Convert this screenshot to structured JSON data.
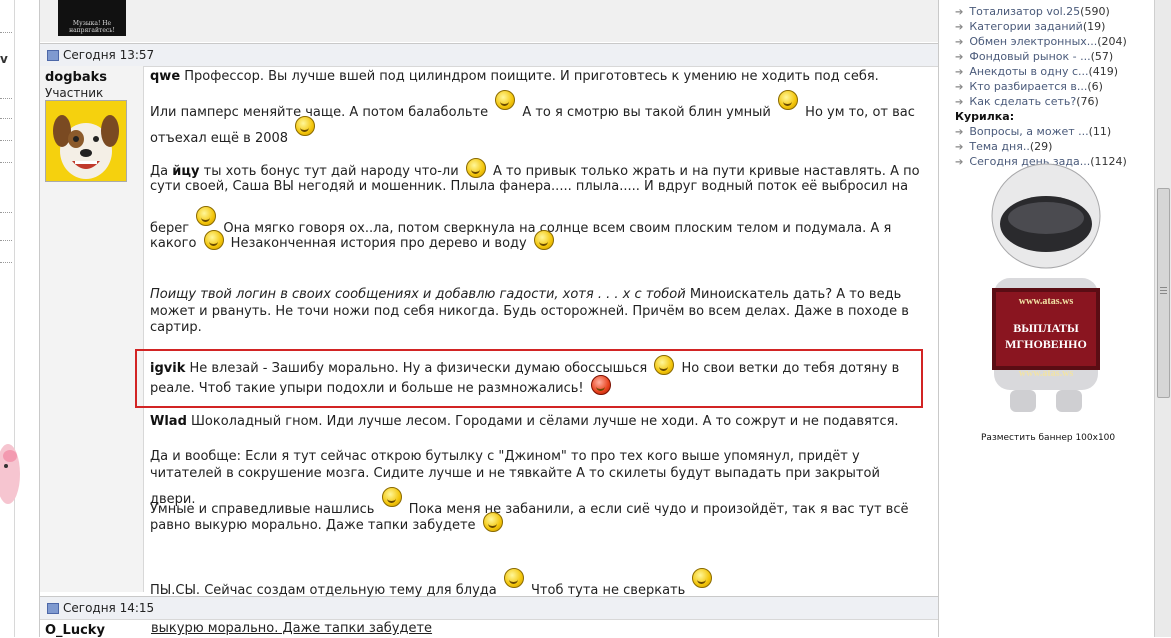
{
  "left_strip": {
    "letter": "v"
  },
  "previous_post": {
    "avatar_caption": "Музыка! Не напрягайтесь!"
  },
  "post1": {
    "date": "Сегодня 13:57",
    "author": "dogbaks",
    "role": "Участник",
    "lines": [
      {
        "bold": "qwe",
        "text": " Профессор. Вы лучше вшей под цилиндром поищите. И приготовтесь к умению не ходить под себя."
      },
      {
        "text": "Или памперс меняйте чаще. А потом балабольте ",
        "text2": " А то я смотрю вы такой блин умный ",
        "text3": " Но ум то, от вас"
      },
      {
        "text": "отъехал ещё в 2008 "
      },
      {
        "text": "Да ",
        "bold": "йцу",
        "text2": " ты хоть бонус тут дай народу что-ли ",
        "text3": " А то привык только жрать и на пути кривые наставлять. А по"
      },
      {
        "text": "сути своей, Саша ВЫ негодяй и мошенник. Плыла фанера..... плыла..... И вдруг водный поток её выбросил на"
      },
      {
        "text": "берег ",
        "text2": " Она мягко говоря ох..ла, потом сверкнула на солнце всем своим плоским телом и подумала. А я"
      },
      {
        "text": "какого ",
        "text2": " Незаконченная история про дерево и воду "
      },
      {
        "italic": "Поищу твой логин в своих сообщениях и добавлю гадости, хотя . . . x с тобой",
        "text": " Миноискатель дать? А то ведь"
      },
      {
        "text": "может и рвануть. Не точи ножи под себя никогда. Будь осторожней. Причём во всем делах. Даже в походе в"
      },
      {
        "text": "сартир."
      },
      {
        "bold": "igvik",
        "text": " Не влезай - Зашибу морально. Ну а физически думаю обоссышься ",
        "text2": " Но свои ветки до тебя дотяну в"
      },
      {
        "text": "реале. Чтоб такие упыри подохли и больше не размножались! "
      },
      {
        "bold": "Wlad",
        "text": " Шоколадный гном. Иди лучше лесом. Городами и сёлами лучше не ходи. А то сожрут и не подавятся."
      },
      {
        "text": "Да и вообще: Если я тут сейчас открою бутылку с \"Джином\" то про тех кого выше упомянул, придёт у"
      },
      {
        "text": "читателей в сокрушение мозга. Сидите лучше и не тявкайте А то скилеты будут выпадать при закрытой двери."
      },
      {
        "text": "Умные и справедливые нашлись ",
        "text2": " Пока меня не забанили, а если сиё чудо и произойдёт, так я вас тут всё"
      },
      {
        "text": "равно выкурю морально. Даже тапки забудете "
      },
      {
        "text": "ПЫ.СЫ. Сейчас создам отдельную тему для блуда ",
        "text2": " Чтоб тута не сверкать "
      }
    ]
  },
  "post2": {
    "date": "Сегодня 14:15",
    "author": "O_Lucky",
    "text": "выкурю морально. Даже тапки забудете"
  },
  "sidebar": {
    "items": [
      {
        "label": "Тотализатор vol.25",
        "count": "(590)"
      },
      {
        "label": "Категории заданий",
        "count": "(19)"
      },
      {
        "label": "Обмен электронных...",
        "count": "(204)"
      },
      {
        "label": "Фондовый рынок - ...",
        "count": "(57)"
      },
      {
        "label": "Анекдоты в одну с...",
        "count": "(419)"
      },
      {
        "label": "Кто разбирается в...",
        "count": "(6)"
      },
      {
        "label": "Как сделать сеть?",
        "count": "(76)"
      }
    ],
    "section": "Курилка:",
    "items2": [
      {
        "label": "Вопросы, а может ...",
        "count": "(11)"
      },
      {
        "label": "Тема дня..",
        "count": "(29)"
      },
      {
        "label": "Сегодня день зада...",
        "count": "(1124)"
      }
    ],
    "banner": {
      "site_top": "www.atas.ws",
      "line1": "ВЫПЛАТЫ",
      "line2": "МГНОВЕННО",
      "site_bottom": "www.atas.ws"
    },
    "banner_label": "Разместить баннер 100x100"
  }
}
